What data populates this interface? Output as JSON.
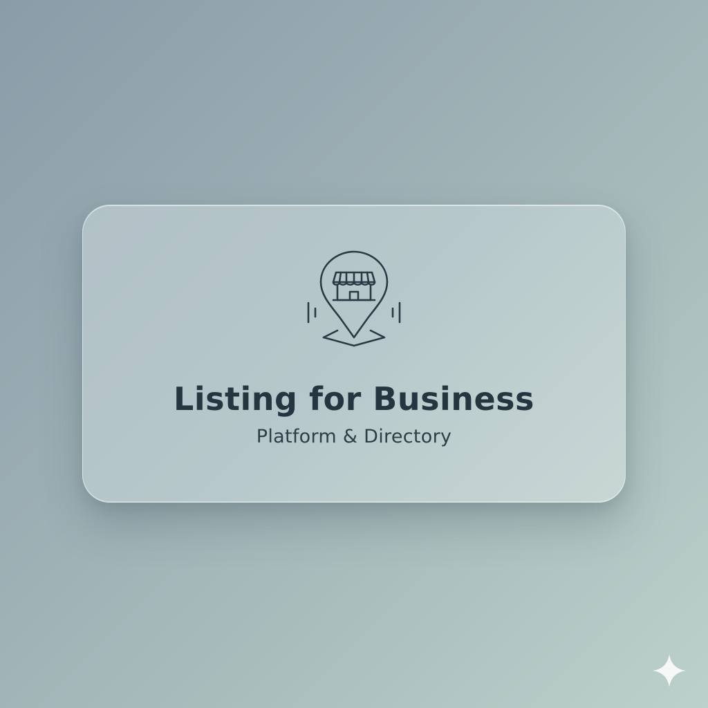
{
  "card": {
    "title": "Listing for Business",
    "subtitle": "Platform & Directory",
    "icon": "store-location-pin-icon"
  },
  "corner_mark": {
    "icon": "sparkle-icon"
  },
  "colors": {
    "text_primary": "#253640",
    "text_secondary": "#2e3e47",
    "icon_stroke": "#2a3a44",
    "background_start": "#8a9ca8",
    "background_end": "#bcd1cb"
  }
}
